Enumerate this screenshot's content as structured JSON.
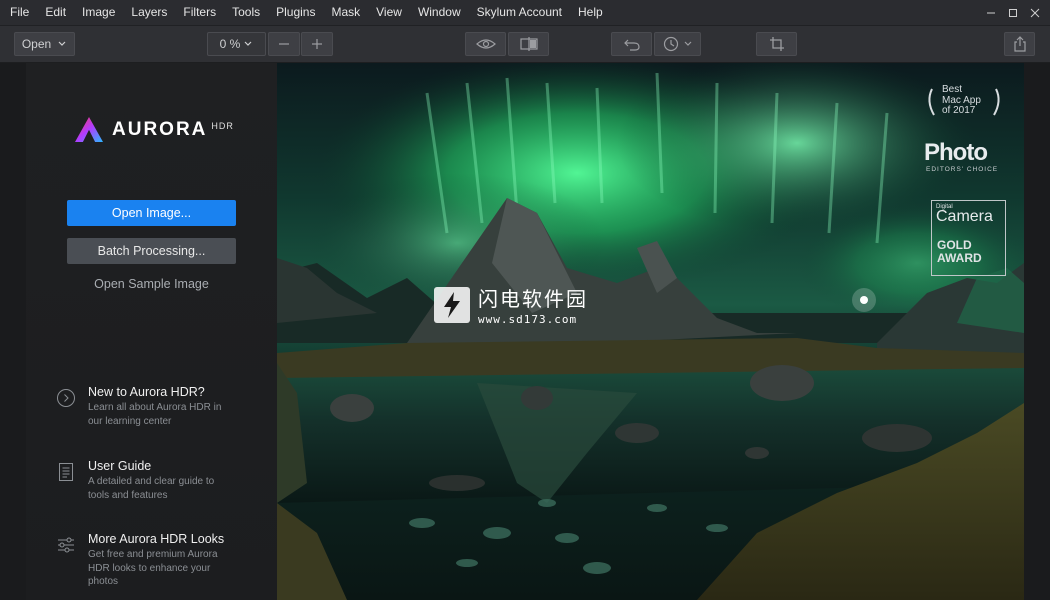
{
  "menu": [
    "File",
    "Edit",
    "Image",
    "Layers",
    "Filters",
    "Tools",
    "Plugins",
    "Mask",
    "View",
    "Window",
    "Skylum Account",
    "Help"
  ],
  "toolbar": {
    "open_label": "Open",
    "zoom_value": "0 %",
    "minus_label": "—",
    "plus_label": "+"
  },
  "left_panel": {
    "logo": {
      "name": "AURORA",
      "sup": "HDR"
    },
    "open_image_label": "Open Image...",
    "batch_label": "Batch Processing...",
    "sample_label": "Open Sample Image",
    "items": [
      {
        "title": "New to Aurora HDR?",
        "desc": "Learn all about Aurora HDR in our learning center",
        "icon": "chevron-circle-icon"
      },
      {
        "title": "User Guide",
        "desc": "A detailed and clear guide to tools and features",
        "icon": "document-icon"
      },
      {
        "title": "More Aurora HDR Looks",
        "desc": "Get free and premium Aurora HDR looks to enhance your photos",
        "icon": "sliders-icon"
      }
    ]
  },
  "photo": {
    "awards": {
      "best_line1": "Best",
      "best_line2": "Mac App",
      "best_line3": "of 2017",
      "photo_title": "Photo",
      "photo_sub": "EDITORS' CHOICE",
      "camera_digital": "Digital",
      "camera_title": "Camera",
      "camera_gold": "GOLD",
      "camera_award": "AWARD"
    },
    "watermark": {
      "title": "闪电软件园",
      "url": "www.sd173.com"
    }
  },
  "colors": {
    "accent": "#1a82f0",
    "aurora": "#2ee27a"
  }
}
